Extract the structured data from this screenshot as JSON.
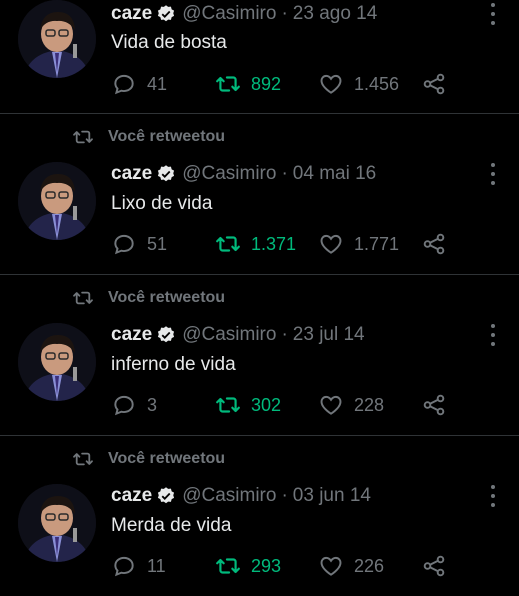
{
  "theme": {
    "background": "#000000",
    "text": "#e7e9ea",
    "muted": "#71767b",
    "retweet_green": "#00ba7c",
    "divider": "#2f3336"
  },
  "icons": {
    "retweet": "retweet-icon",
    "reply": "reply-icon",
    "like": "heart-icon",
    "share": "share-icon",
    "more": "more-options-icon",
    "verified": "verified-badge-icon"
  },
  "tweets": [
    {
      "retweeted_label": "",
      "name": "caze",
      "handle": "@Casimiro",
      "sep": "·",
      "date": "23 ago 14",
      "text": "Vida de bosta",
      "replies": "41",
      "retweets": "892",
      "likes": "1.456"
    },
    {
      "retweeted_label": "Você retweetou",
      "name": "caze",
      "handle": "@Casimiro",
      "sep": "·",
      "date": "04 mai 16",
      "text": "Lixo de vida",
      "replies": "51",
      "retweets": "1.371",
      "likes": "1.771"
    },
    {
      "retweeted_label": "Você retweetou",
      "name": "caze",
      "handle": "@Casimiro",
      "sep": "·",
      "date": "23 jul 14",
      "text": "inferno de vida",
      "replies": "3",
      "retweets": "302",
      "likes": "228"
    },
    {
      "retweeted_label": "Você retweetou",
      "name": "caze",
      "handle": "@Casimiro",
      "sep": "·",
      "date": "03 jun 14",
      "text": "Merda de vida",
      "replies": "11",
      "retweets": "293",
      "likes": "226"
    }
  ]
}
